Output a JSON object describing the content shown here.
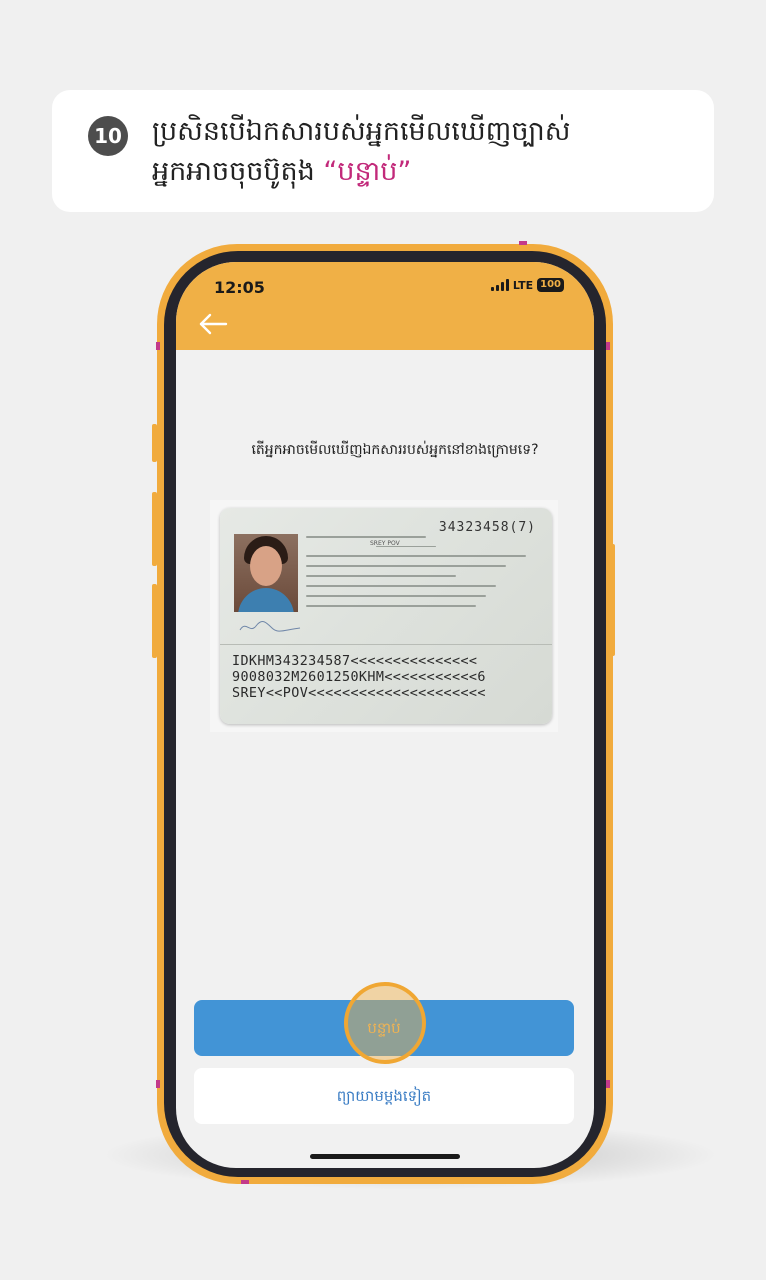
{
  "instruction": {
    "step_number": "10",
    "line1": "ប្រសិនបើឯកសារបស់អ្នកមើលឃើញច្បាស់",
    "line2_prefix": "អ្នកអាចចុចប៊ូតុង ",
    "line2_highlight": "“បន្ទាប់”",
    "highlight_color": "#c2297a"
  },
  "status_bar": {
    "time": "12:05",
    "network": "LTE",
    "battery": "100"
  },
  "header": {
    "back_icon": "arrow-left-icon",
    "color": "#f0b046"
  },
  "main": {
    "question": "តើអ្នកអាចមើលឃើញឯកសាររបស់អ្នកនៅខាងក្រោមទេ?"
  },
  "id_card": {
    "number": "34323458(7)",
    "name": "SREY POV",
    "mrz_line1": "IDKHM343234587<<<<<<<<<<<<<<<",
    "mrz_line2": "9008032M2601250KHM<<<<<<<<<<<6",
    "mrz_line3": "SREY<<POV<<<<<<<<<<<<<<<<<<<<<"
  },
  "buttons": {
    "next_label": "បន្ទាប់",
    "retry_label": "ព្យាយាមម្តងទៀត",
    "next_color": "#4294d6"
  }
}
